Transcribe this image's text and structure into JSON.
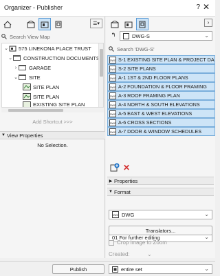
{
  "window": {
    "title": "Organizer - Publisher",
    "help": "?",
    "close": "✕"
  },
  "left": {
    "search_placeholder": "Search View Map",
    "tree": [
      {
        "label": "575 LINEKONA PLACE TRUST"
      },
      {
        "label": "CONSTRUCTION DOCUMENTS"
      },
      {
        "label": "GARAGE"
      },
      {
        "label": "SITE"
      },
      {
        "label": "SITE PLAN"
      },
      {
        "label": "SITE PLAN"
      },
      {
        "label": "EXISTING SITE PLAN"
      }
    ],
    "add_shortcut": "Add Shortcut >>>",
    "view_properties": "View Properties",
    "no_selection": "No Selection."
  },
  "right": {
    "set_name": "DWG-S",
    "search_placeholder": "Search 'DWG-S'",
    "layouts": [
      {
        "label": "S-1 EXISTING SITE PLAN & PROJECT DA"
      },
      {
        "label": "S-2 SITE PLANS"
      },
      {
        "label": "A-1 1ST & 2ND FLOOR PLANS"
      },
      {
        "label": "A-2 FOUNDATION & FLOOR FRAMING"
      },
      {
        "label": "A-3 ROOF FRAMING PLAN"
      },
      {
        "label": "A-4 NORTH & SOUTH ELEVATIONS"
      },
      {
        "label": "A-5 EAST & WEST ELEVATIONS"
      },
      {
        "label": "A-6 CROSS SECTIONS"
      },
      {
        "label": "A-7 DOOR & WINDOW SCHEDULES"
      }
    ],
    "properties": "Properties",
    "format": "Format",
    "format_value": "DWG",
    "translator_value": "01 For further editing",
    "translators_button": "Translators...",
    "crop_label": "Crop image to Zoom",
    "created_label": "Created:"
  },
  "bottom": {
    "publish": "Publish",
    "set_scope": "entire set"
  },
  "colors": {
    "selection": "#cde4f7",
    "selection_border": "#7aaedb",
    "delete_red": "#d32f2f",
    "add_blue": "#1e73c8"
  }
}
